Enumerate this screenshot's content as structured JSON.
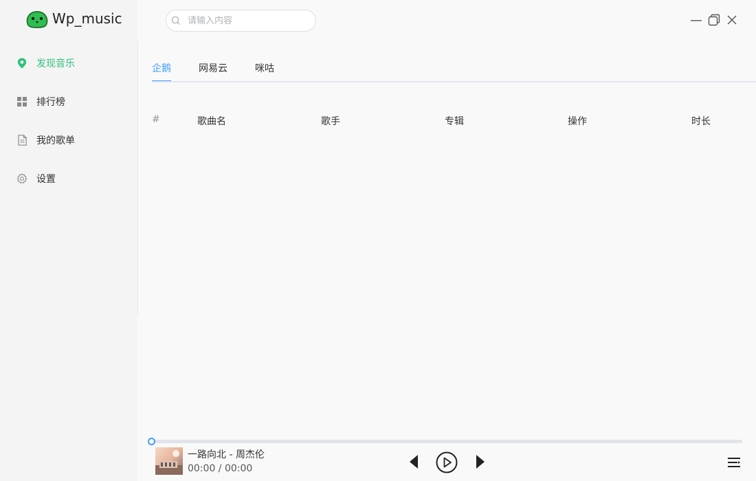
{
  "app": {
    "name": "Wp_music",
    "brand_color": "#31c27c",
    "accent_color": "#409eff"
  },
  "search": {
    "placeholder": "请输入内容",
    "value": ""
  },
  "sidebar": {
    "items": [
      {
        "label": "发现音乐",
        "icon": "location-pin-icon",
        "active": true
      },
      {
        "label": "排行榜",
        "icon": "grid-icon",
        "active": false
      },
      {
        "label": "我的歌单",
        "icon": "document-icon",
        "active": false
      },
      {
        "label": "设置",
        "icon": "gear-icon",
        "active": false
      }
    ]
  },
  "window_controls": {
    "icons": [
      "minimize-icon",
      "maximize-icon",
      "close-icon"
    ]
  },
  "tabs": [
    {
      "label": "企鹅",
      "active": true
    },
    {
      "label": "网易云",
      "active": false
    },
    {
      "label": "咪咕",
      "active": false
    }
  ],
  "table": {
    "columns": [
      "#",
      "歌曲名",
      "歌手",
      "专辑",
      "操作",
      "时长"
    ],
    "rows": []
  },
  "player": {
    "song": "一路向北 - 周杰伦",
    "time": "00:00 / 00:00",
    "progress": 0
  }
}
